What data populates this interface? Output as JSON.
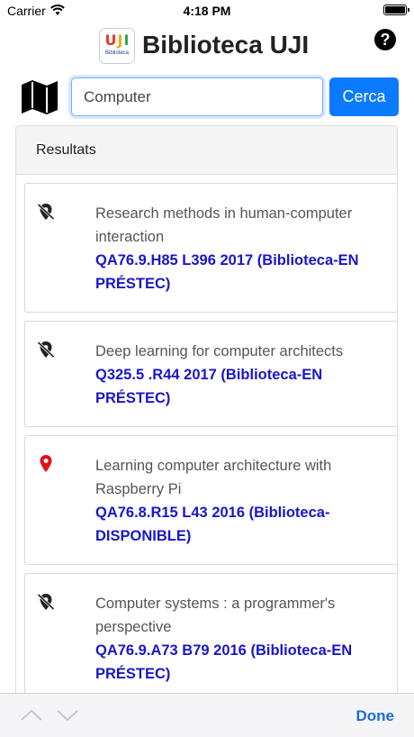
{
  "status_bar": {
    "carrier": "Carrier",
    "time": "4:18 PM"
  },
  "header": {
    "logo_letters": [
      "U",
      "J",
      "I"
    ],
    "logo_subtitle": "Biblioteca",
    "title": "Biblioteca UJI",
    "help_label": "?"
  },
  "search": {
    "value": "Computer",
    "button_label": "Cerca"
  },
  "results": {
    "heading": "Resultats",
    "items": [
      {
        "title": "Research methods in human-computer interaction",
        "call_number": "QA76.9.H85 L396 2017 (Biblioteca-EN PRÉSTEC)",
        "status_icon": "location-off-icon"
      },
      {
        "title": "Deep learning for computer architects",
        "call_number": "Q325.5 .R44 2017 (Biblioteca-EN PRÉSTEC)",
        "status_icon": "location-off-icon"
      },
      {
        "title": "Learning computer architecture with Raspberry Pi",
        "call_number": "QA76.8.R15 L43 2016 (Biblioteca-DISPONIBLE)",
        "status_icon": "location-pin-icon"
      },
      {
        "title": "Computer systems : a programmer's perspective",
        "call_number": "QA76.9.A73 B79 2016 (Biblioteca-EN PRÉSTEC)",
        "status_icon": "location-off-icon"
      }
    ]
  },
  "toolbar": {
    "done_label": "Done"
  },
  "colors": {
    "accent": "#0a7bff",
    "call_number": "#1a16c8",
    "available_pin": "#e0141e"
  }
}
